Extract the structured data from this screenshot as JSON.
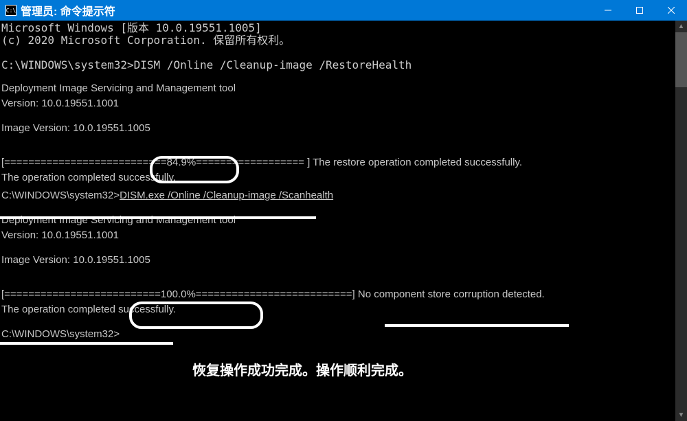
{
  "titlebar": {
    "icon_text": "C:\\",
    "title": "管理员: 命令提示符"
  },
  "terminal": {
    "line1": "Microsoft Windows [版本 10.0.19551.1005]",
    "line2": "(c) 2020 Microsoft Corporation. 保留所有权利。",
    "prompt1_path": "C:\\WINDOWS\\system32>",
    "prompt1_cmd": "DISM /Online /Cleanup-image /RestoreHealth",
    "dism_title": "Deployment Image Servicing and Management tool",
    "dism_ver": "Version: 10.0.19551.1001",
    "img_ver": "Image Version: 10.0.19551.1005",
    "progress1_a": "[===========================84.9%====",
    "progress1_b": "==============         ] The restore operation completed successfully.",
    "op_done": "The operation completed successfully.",
    "prompt2_path": "C:\\WINDOWS\\system32>",
    "prompt2_cmd": "DISM.exe /Online /Cleanup-image /Scanhealth",
    "progress2_a": "[==========================100.0%=======",
    "progress2_b": "===================] No component store corruption detected.",
    "prompt3": "C:\\WINDOWS\\system32>"
  },
  "annotations": {
    "overlay_text": "恢复操作成功完成。操作顺利完成。"
  }
}
